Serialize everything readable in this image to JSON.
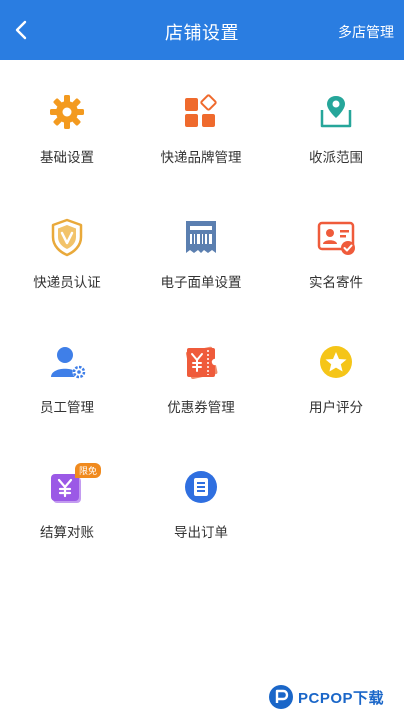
{
  "header": {
    "title": "店铺设置",
    "right_action": "多店管理",
    "back_icon": "chevron-left-icon"
  },
  "grid": {
    "items": [
      {
        "label": "基础设置",
        "icon": "gear-icon"
      },
      {
        "label": "快递品牌管理",
        "icon": "brand-grid-icon"
      },
      {
        "label": "收派范围",
        "icon": "map-pin-icon"
      },
      {
        "label": "快递员认证",
        "icon": "shield-v-icon"
      },
      {
        "label": "电子面单设置",
        "icon": "barcode-receipt-icon"
      },
      {
        "label": "实名寄件",
        "icon": "id-card-icon"
      },
      {
        "label": "员工管理",
        "icon": "staff-gear-icon"
      },
      {
        "label": "优惠券管理",
        "icon": "coupon-icon"
      },
      {
        "label": "用户评分",
        "icon": "star-circle-icon"
      },
      {
        "label": "结算对账",
        "icon": "settlement-yen-icon",
        "badge": "限免"
      },
      {
        "label": "导出订单",
        "icon": "export-list-icon"
      }
    ]
  },
  "watermark": {
    "text": "PCPOP下载"
  },
  "colors": {
    "header_bg": "#2a7de1",
    "orange": "#f39a1f",
    "green": "#26a69a",
    "blue": "#3f7fe8",
    "red": "#ef5b3b"
  }
}
